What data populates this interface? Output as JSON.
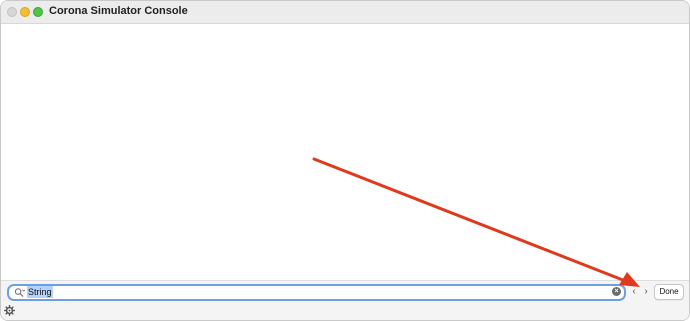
{
  "window": {
    "title": "Corona Simulator Console"
  },
  "findbar": {
    "search_value": "String",
    "done_label": "Done",
    "prev_glyph": "‹",
    "next_glyph": "›",
    "clear_glyph": "×"
  },
  "icons": {
    "search": "magnifier-icon",
    "clear": "clear-icon",
    "prev": "chevron-left-icon",
    "next": "chevron-right-icon",
    "settings": "gear-icon",
    "annotation": "red-arrow-icon"
  },
  "colors": {
    "focus_ring": "#6f9fe0",
    "selection": "#b3d2fb",
    "annotation_arrow": "#e03a1e",
    "minimize": "#f5bf2f",
    "maximize": "#4fc446"
  }
}
